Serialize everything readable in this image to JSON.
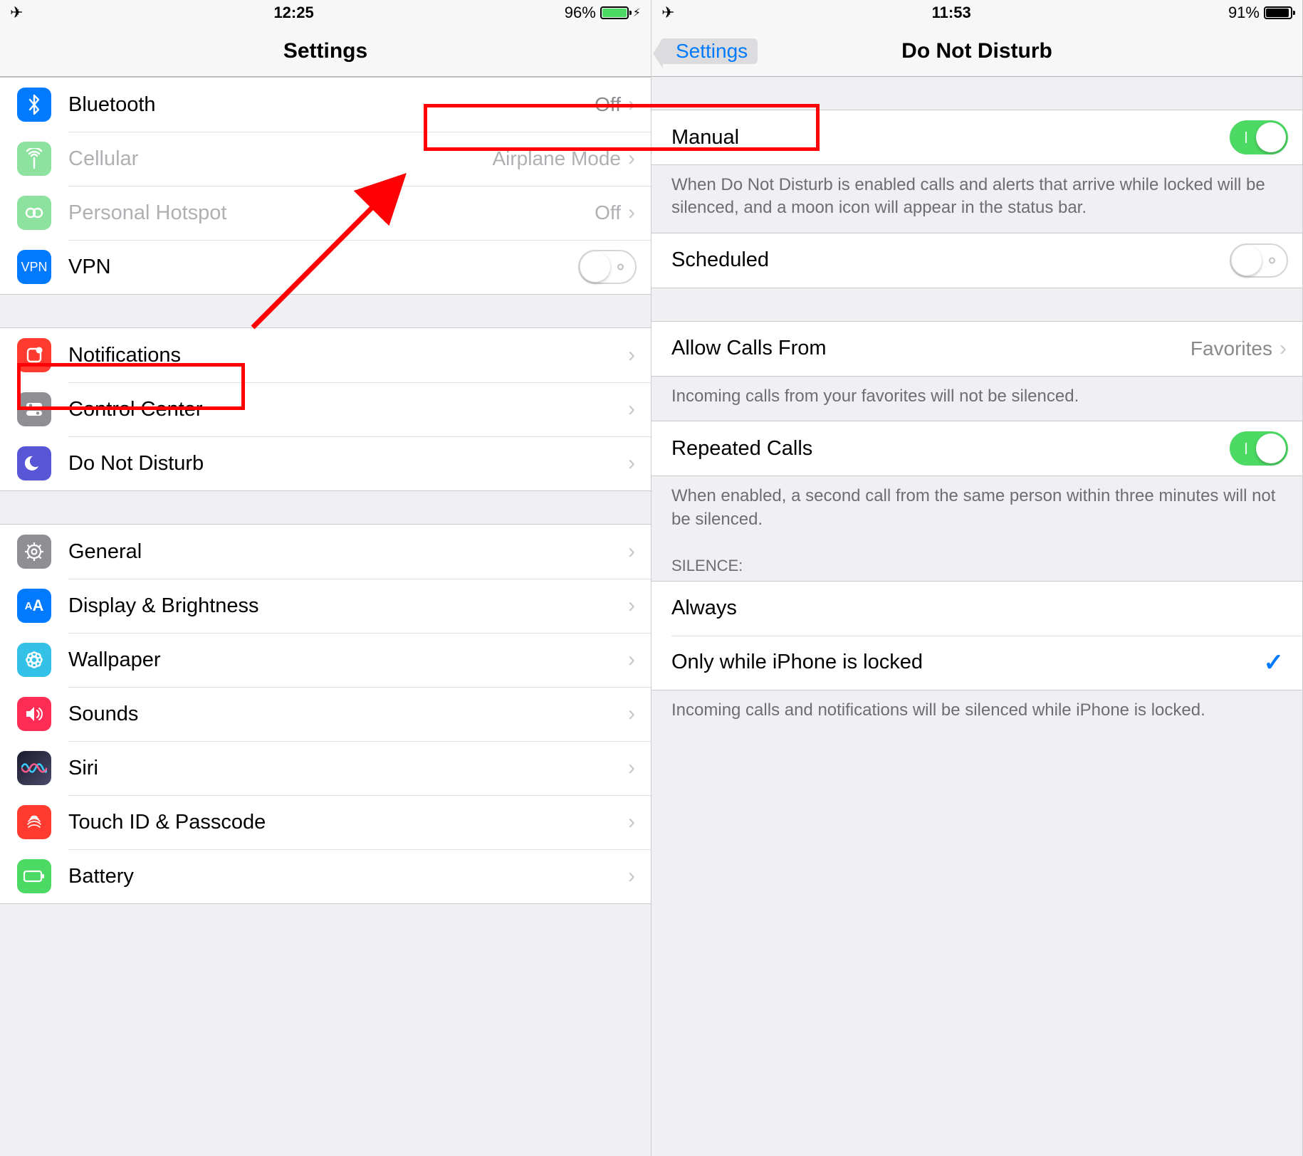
{
  "left": {
    "status": {
      "time": "12:25",
      "battery": "96%"
    },
    "title": "Settings",
    "rows": [
      {
        "id": "bluetooth",
        "label": "Bluetooth",
        "value": "Off",
        "chevron_text": "›"
      },
      {
        "id": "cellular",
        "label": "Cellular",
        "value": "Airplane Mode",
        "chevron_text": "›"
      },
      {
        "id": "hotspot",
        "label": "Personal Hotspot",
        "value": "Off",
        "chevron_text": "›"
      },
      {
        "id": "vpn",
        "label": "VPN"
      },
      {
        "id": "notifications",
        "label": "Notifications",
        "chevron_text": "›"
      },
      {
        "id": "control-center",
        "label": "Control Center",
        "chevron_text": "›"
      },
      {
        "id": "dnd",
        "label": "Do Not Disturb",
        "chevron_text": "›"
      },
      {
        "id": "general",
        "label": "General",
        "chevron_text": "›"
      },
      {
        "id": "display",
        "label": "Display & Brightness",
        "chevron_text": "›"
      },
      {
        "id": "wallpaper",
        "label": "Wallpaper",
        "chevron_text": "›"
      },
      {
        "id": "sounds",
        "label": "Sounds",
        "chevron_text": "›"
      },
      {
        "id": "siri",
        "label": "Siri",
        "chevron_text": "›"
      },
      {
        "id": "touchid",
        "label": "Touch ID & Passcode",
        "chevron_text": "›"
      },
      {
        "id": "battery",
        "label": "Battery",
        "chevron_text": "›"
      }
    ]
  },
  "right": {
    "status": {
      "time": "11:53",
      "battery": "91%"
    },
    "back": "Settings",
    "title": "Do Not Disturb",
    "manual_label": "Manual",
    "manual_footer": "When Do Not Disturb is enabled calls and alerts that arrive while locked will be silenced, and a moon icon will appear in the status bar.",
    "scheduled_label": "Scheduled",
    "allow_label": "Allow Calls From",
    "allow_value": "Favorites",
    "allow_chevron": "›",
    "allow_footer": "Incoming calls from your favorites will not be silenced.",
    "repeated_label": "Repeated Calls",
    "repeated_footer": "When enabled, a second call from the same person within three minutes will not be silenced.",
    "silence_header": "SILENCE:",
    "silence_always": "Always",
    "silence_locked": "Only while iPhone is locked",
    "silence_footer": "Incoming calls and notifications will be silenced while iPhone is locked."
  }
}
